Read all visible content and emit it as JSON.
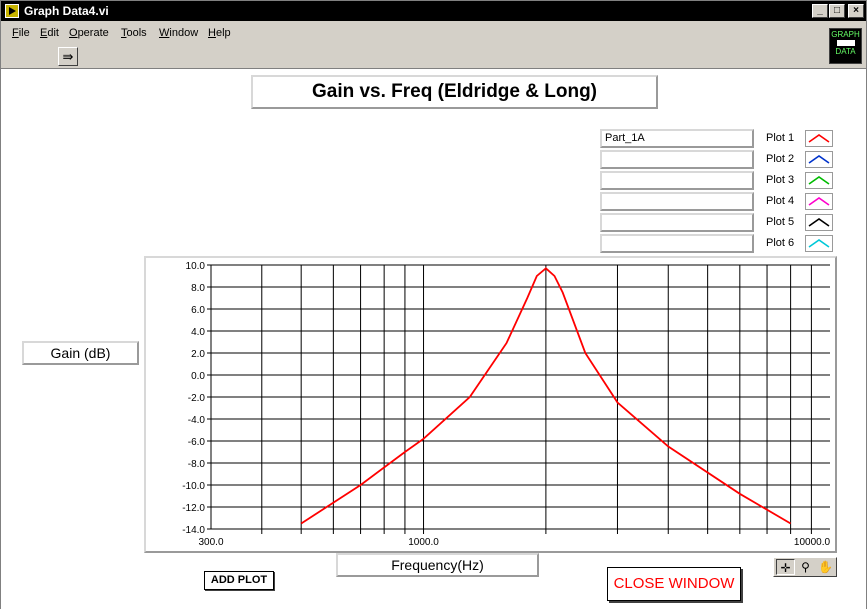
{
  "window": {
    "title": "Graph Data4.vi",
    "minimize": "_",
    "maximize": "□",
    "close": "×"
  },
  "menu": [
    "File",
    "Edit",
    "Operate",
    "Tools",
    "Window",
    "Help"
  ],
  "toolbar": {
    "run_glyph": "⇛"
  },
  "vi_icon": {
    "line1": "GRAPH",
    "line2": "DATA"
  },
  "graph": {
    "title": "Gain vs. Freq (Eldridge & Long)"
  },
  "legend": [
    {
      "name": "Part_1A",
      "label": "Plot 1",
      "color": "#ff0000"
    },
    {
      "name": "",
      "label": "Plot 2",
      "color": "#0033cc"
    },
    {
      "name": "",
      "label": "Plot 3",
      "color": "#00bb00"
    },
    {
      "name": "",
      "label": "Plot 4",
      "color": "#ff00cc"
    },
    {
      "name": "",
      "label": "Plot 5",
      "color": "#000000"
    },
    {
      "name": "",
      "label": "Plot 6",
      "color": "#00c8d8"
    }
  ],
  "axes": {
    "ylabel": "Gain (dB)",
    "xlabel": "Frequency(Hz)"
  },
  "buttons": {
    "add_plot": "ADD PLOT",
    "close_window": "CLOSE WINDOW"
  },
  "palette": {
    "cursor_icon": "✛",
    "zoom_icon": "⚲",
    "pan_icon": "✋"
  },
  "chart_data": {
    "type": "line",
    "xlabel": "Frequency(Hz)",
    "ylabel": "Gain (dB)",
    "x_scale": "log",
    "xlim": [
      300,
      10000
    ],
    "ylim": [
      -14,
      10
    ],
    "grid": true,
    "x_tick_labels": [
      {
        "value": 300,
        "label": "300.0"
      },
      {
        "value": 1000,
        "label": "1000.0"
      },
      {
        "value": 10000,
        "label": "10000.0"
      }
    ],
    "x_grid_values": [
      400,
      500,
      600,
      700,
      800,
      900,
      1000,
      2000,
      3000,
      4000,
      5000,
      6000,
      7000,
      8000,
      9000
    ],
    "y_ticks": [
      {
        "value": 10,
        "label": "10.0"
      },
      {
        "value": 8,
        "label": "8.0"
      },
      {
        "value": 6,
        "label": "6.0"
      },
      {
        "value": 4,
        "label": "4.0"
      },
      {
        "value": 2,
        "label": "2.0"
      },
      {
        "value": 0,
        "label": "0.0"
      },
      {
        "value": -2,
        "label": "-2.0"
      },
      {
        "value": -4,
        "label": "-4.0"
      },
      {
        "value": -6,
        "label": "-6.0"
      },
      {
        "value": -8,
        "label": "-8.0"
      },
      {
        "value": -10,
        "label": "-10.0"
      },
      {
        "value": -12,
        "label": "-12.0"
      },
      {
        "value": -14,
        "label": "-14.0"
      }
    ],
    "series": [
      {
        "name": "Part_1A",
        "color": "#ff0000",
        "x": [
          500,
          700,
          900,
          1000,
          1300,
          1600,
          1800,
          1900,
          2000,
          2100,
          2200,
          2500,
          3000,
          4000,
          6000,
          8000
        ],
        "y": [
          -13.5,
          -10.0,
          -7.0,
          -5.8,
          -2.0,
          2.9,
          7.0,
          9.0,
          9.7,
          9.0,
          7.5,
          2.0,
          -2.5,
          -6.5,
          -10.8,
          -13.5
        ]
      }
    ]
  }
}
